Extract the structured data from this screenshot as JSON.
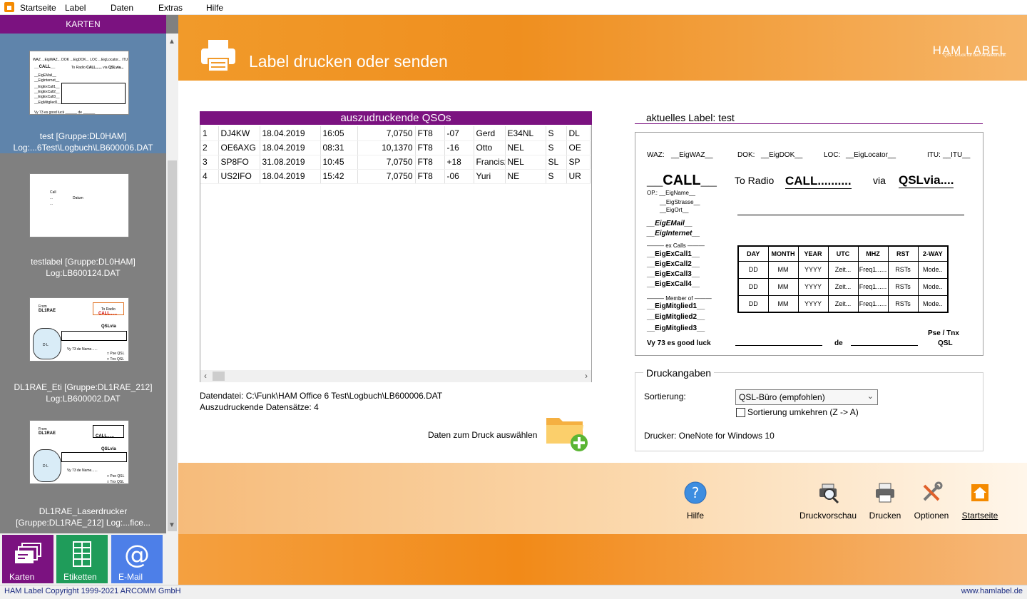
{
  "menubar": {
    "items": [
      "Startseite",
      "Label",
      "Daten",
      "Extras",
      "Hilfe"
    ]
  },
  "sidebar": {
    "header": "KARTEN",
    "thumbnails": [
      {
        "line1": "test [Gruppe:DL0HAM]",
        "line2": "Log:...6Test\\Logbuch\\LB600006.DAT"
      },
      {
        "line1": "testlabel [Gruppe:DL0HAM]",
        "line2": "Log:LB600124.DAT"
      },
      {
        "line1": "DL1RAE_Eti [Gruppe:DL1RAE_212]",
        "line2": "Log:LB600002.DAT"
      },
      {
        "line1": "DL1RAE_Laserdrucker",
        "line2": "[Gruppe:DL1RAE_212] Log:...fice..."
      }
    ]
  },
  "bottomtabs": {
    "karten": "Karten",
    "etiketten": "Etiketten",
    "email": "E-Mail"
  },
  "banner": {
    "title": "Label drucken oder senden",
    "brand": "HAM LABEL",
    "brand_sub": "QSL- Druck für den Amateurfunk"
  },
  "qso": {
    "header": "auszudruckende QSOs",
    "rows": [
      [
        "1",
        "DJ4KW",
        "18.04.2019",
        "16:05",
        "7,0750",
        "FT8",
        "-07",
        "Gerd",
        "E34NL",
        "S",
        "DL"
      ],
      [
        "2",
        "OE6AXG",
        "18.04.2019",
        "08:31",
        "10,1370",
        "FT8",
        "-16",
        "Otto",
        "NEL",
        "S",
        "OE"
      ],
      [
        "3",
        "SP8FO",
        "31.08.2019",
        "10:45",
        "7,0750",
        "FT8",
        "+18",
        "Francisz",
        "NEL",
        "SL",
        "SP"
      ],
      [
        "4",
        "US2IFO",
        "18.04.2019",
        "15:42",
        "7,0750",
        "FT8",
        "-06",
        "Yuri",
        "NE",
        "S",
        "UR"
      ]
    ]
  },
  "info": {
    "datafile": "Datendatei: C:\\Funk\\HAM Office 6 Test\\Logbuch\\LB600006.DAT",
    "count": "Auszudruckende Datensätze: 4",
    "select_label": "Daten zum Druck auswählen"
  },
  "label": {
    "header": "aktuelles Label: test",
    "waz": "WAZ:",
    "waz_v": "__EigWAZ__",
    "dok": "DOK:",
    "dok_v": "__EigDOK__",
    "loc": "LOC:",
    "loc_v": "__EigLocator__",
    "itu": "ITU:",
    "itu_v": "__ITU__",
    "call": "__CALL__",
    "to_radio": "To Radio",
    "call2": "CALL..........",
    "via": "via",
    "qslvia": "QSLvia....",
    "op": "OP.:  __EigName__",
    "street": "__EigStrasse__",
    "city": "__EigOrt__",
    "email": "__EigEMail__",
    "internet": "__EigInternet__",
    "excalls": "ex Calls",
    "ex1": "__EigExCall1__",
    "ex2": "__EigExCall2__",
    "ex3": "__EigExCall3__",
    "ex4": "__EigExCall4__",
    "member": "Member of",
    "m1": "__EigMitglied1__",
    "m2": "__EigMitglied2__",
    "m3": "__EigMitglied3__",
    "table_head": [
      "DAY",
      "MONTH",
      "YEAR",
      "UTC",
      "MHZ",
      "RST",
      "2-WAY"
    ],
    "table_row": [
      "DD",
      "MM",
      "YYYY",
      "Zeit...",
      "Freq1......",
      "RSTs",
      "Mode.."
    ],
    "vy73": "Vy 73 es good luck",
    "de": "de",
    "pse": "Pse / Tnx",
    "qsl": "QSL"
  },
  "druck": {
    "title": "Druckangaben",
    "sort_label": "Sortierung:",
    "sort_value": "QSL-Büro (empfohlen)",
    "reverse": "Sortierung umkehren (Z -> A)",
    "printer": "Drucker: OneNote for Windows 10"
  },
  "actions": {
    "hilfe": "Hilfe",
    "preview": "Druckvorschau",
    "print": "Drucken",
    "options": "Optionen",
    "home": "Startseite"
  },
  "status": {
    "copyright": "HAM Label Copyright 1999-2021 ARCOMM GmbH",
    "url": "www.hamlabel.de"
  },
  "colors": {
    "accent": "#7b1280",
    "orange": "#f28a18",
    "selection": "#5f84ab"
  }
}
